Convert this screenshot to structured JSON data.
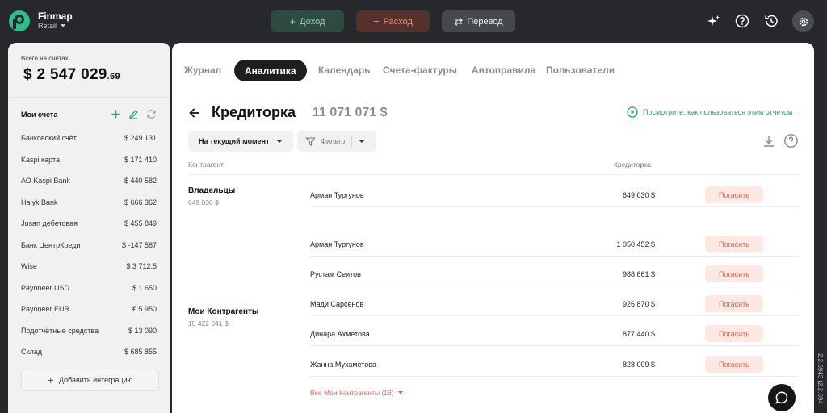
{
  "brand": {
    "name": "Finmap",
    "workspace": "Retail"
  },
  "top_actions": {
    "income": "Доход",
    "expense": "Расход",
    "transfer": "Перевод"
  },
  "sidebar": {
    "balance_label": "Всего на счетах",
    "balance_main": "$ 2 547 029",
    "balance_cents": ".69",
    "accounts_title": "Мои счета",
    "accounts": [
      {
        "name": "Банковский счёт",
        "amount": "$ 249 131"
      },
      {
        "name": "Kaspi карта",
        "amount": "$ 171 410"
      },
      {
        "name": "АО Kaspi Bank",
        "amount": "$ 440 582"
      },
      {
        "name": "Halyk Bank",
        "amount": "$ 666 362"
      },
      {
        "name": "Jusan дебетовая",
        "amount": "$ 455 849"
      },
      {
        "name": "Банк ЦентрКредит",
        "amount": "$ -147 587"
      },
      {
        "name": "Wise",
        "amount": "$ 3 712.5"
      },
      {
        "name": "Payoneer USD",
        "amount": "$ 1 650"
      },
      {
        "name": "Payoneer EUR",
        "amount": "€ 5 950"
      },
      {
        "name": "Подотчётные средства",
        "amount": "$ 13 090"
      },
      {
        "name": "Склад",
        "amount": "$ 685 855"
      }
    ],
    "add_integration": "Добавить интеграцию"
  },
  "tabs": [
    {
      "label": "Журнал",
      "active": false
    },
    {
      "label": "Аналитика",
      "active": true
    },
    {
      "label": "Календарь",
      "active": false
    },
    {
      "label": "Счета-фактуры",
      "active": false
    },
    {
      "label": "Автоправила",
      "active": false
    },
    {
      "label": "Пользователи",
      "active": false
    }
  ],
  "report": {
    "title": "Кредиторка",
    "total": "11 071 071 $",
    "howto_link": "Посмотрите, как пользоваться этим отчетом",
    "period_select": "На текущий момент",
    "filter_label": "Фильтр",
    "col_counterparty": "Контрагент",
    "col_payable": "Кредиторка",
    "repay_label": "Погасить",
    "groups": [
      {
        "name": "Владельцы",
        "sum": "649 030 $",
        "rows": [
          {
            "name": "Арман Тургунов",
            "amount": "649 030 $"
          }
        ]
      },
      {
        "name": "Мои Контрагенты",
        "sum": "10 422 041 $",
        "rows": [
          {
            "name": "Арман Тургунов",
            "amount": "1 050 452 $"
          },
          {
            "name": "Рустам Сеитов",
            "amount": "988 661 $"
          },
          {
            "name": "Мади Сарсенов",
            "amount": "926 870 $"
          },
          {
            "name": "Динара Ахметова",
            "amount": "877 440 $"
          },
          {
            "name": "Жанна Мухаметова",
            "amount": "828 009 $"
          }
        ],
        "show_all": "Все Мои Контрагенты (16)"
      }
    ]
  },
  "version": "2.2.6943 (2.2.694",
  "colors": {
    "background": "#26282b",
    "income": "#8ed3ad",
    "expense": "#ee8d7c",
    "accent_green": "#2ea36e",
    "repay_text": "#e46a56",
    "repay_bg": "#fde8e4"
  }
}
